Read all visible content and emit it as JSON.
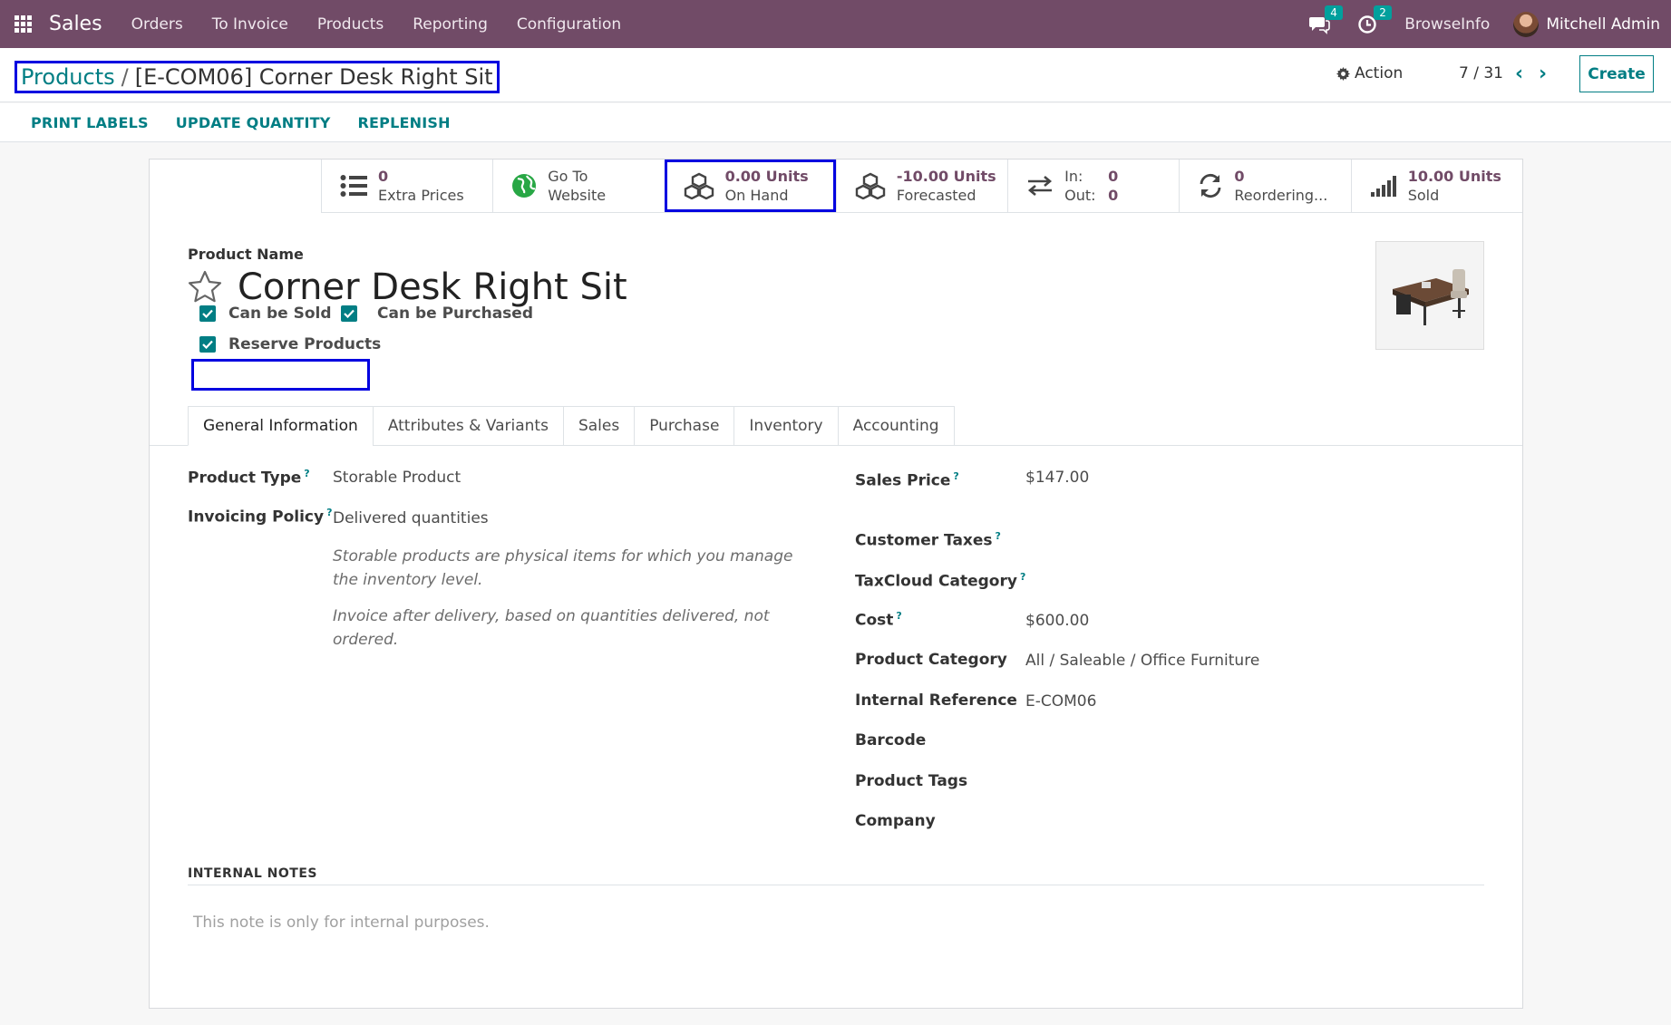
{
  "navbar": {
    "app_name": "Sales",
    "menu": [
      "Orders",
      "To Invoice",
      "Products",
      "Reporting",
      "Configuration"
    ],
    "messages_count": "4",
    "activities_count": "2",
    "company": "BrowseInfo",
    "user": "Mitchell Admin"
  },
  "breadcrumb": {
    "parent": "Products",
    "separator": "/",
    "current": "[E-COM06] Corner Desk Right Sit"
  },
  "control": {
    "action_label": "Action",
    "pager": "7 / 31",
    "create_label": "Create"
  },
  "header_buttons": [
    "PRINT LABELS",
    "UPDATE QUANTITY",
    "REPLENISH"
  ],
  "smart_buttons": {
    "extra_prices": {
      "value": "0",
      "label": "Extra Prices",
      "icon": "list-icon"
    },
    "website": {
      "value": "Go To",
      "label": "Website",
      "icon": "globe-icon"
    },
    "on_hand": {
      "value": "0.00 Units",
      "label": "On Hand",
      "icon": "cubes-icon"
    },
    "forecasted": {
      "value": "-10.00 Units",
      "label": "Forecasted",
      "icon": "cubes-icon"
    },
    "in_out": {
      "in_label": "In:",
      "in_value": "0",
      "out_label": "Out:",
      "out_value": "0",
      "icon": "exchange-icon"
    },
    "reordering": {
      "value": "0",
      "label": "Reordering...",
      "icon": "refresh-icon"
    },
    "sold": {
      "value": "10.00 Units",
      "label": "Sold",
      "icon": "signal-icon"
    }
  },
  "product": {
    "name_caption": "Product Name",
    "name": "Corner Desk Right Sit",
    "can_be_sold": "Can be Sold",
    "can_be_purchased": "Can be Purchased",
    "reserve_products": "Reserve Products"
  },
  "tabs": [
    "General Information",
    "Attributes & Variants",
    "Sales",
    "Purchase",
    "Inventory",
    "Accounting"
  ],
  "general": {
    "product_type_label": "Product Type",
    "product_type": "Storable Product",
    "invoicing_policy_label": "Invoicing Policy",
    "invoicing_policy": "Delivered quantities",
    "help_type": "Storable products are physical items for which you manage the inventory level.",
    "help_invoice": "Invoice after delivery, based on quantities delivered, not ordered.",
    "sales_price_label": "Sales Price",
    "sales_price": "$147.00",
    "customer_taxes_label": "Customer Taxes",
    "taxcloud_label": "TaxCloud Category",
    "cost_label": "Cost",
    "cost": "$600.00",
    "category_label": "Product Category",
    "category": "All / Saleable / Office Furniture",
    "internal_ref_label": "Internal Reference",
    "internal_ref": "E-COM06",
    "barcode_label": "Barcode",
    "tags_label": "Product Tags",
    "company_label": "Company",
    "help_marker": "?"
  },
  "notes": {
    "title": "INTERNAL NOTES",
    "placeholder": "This note is only for internal purposes."
  },
  "colors": {
    "navbar": "#714b67",
    "accent": "#017e84",
    "highlight_box": "#0000e0"
  }
}
